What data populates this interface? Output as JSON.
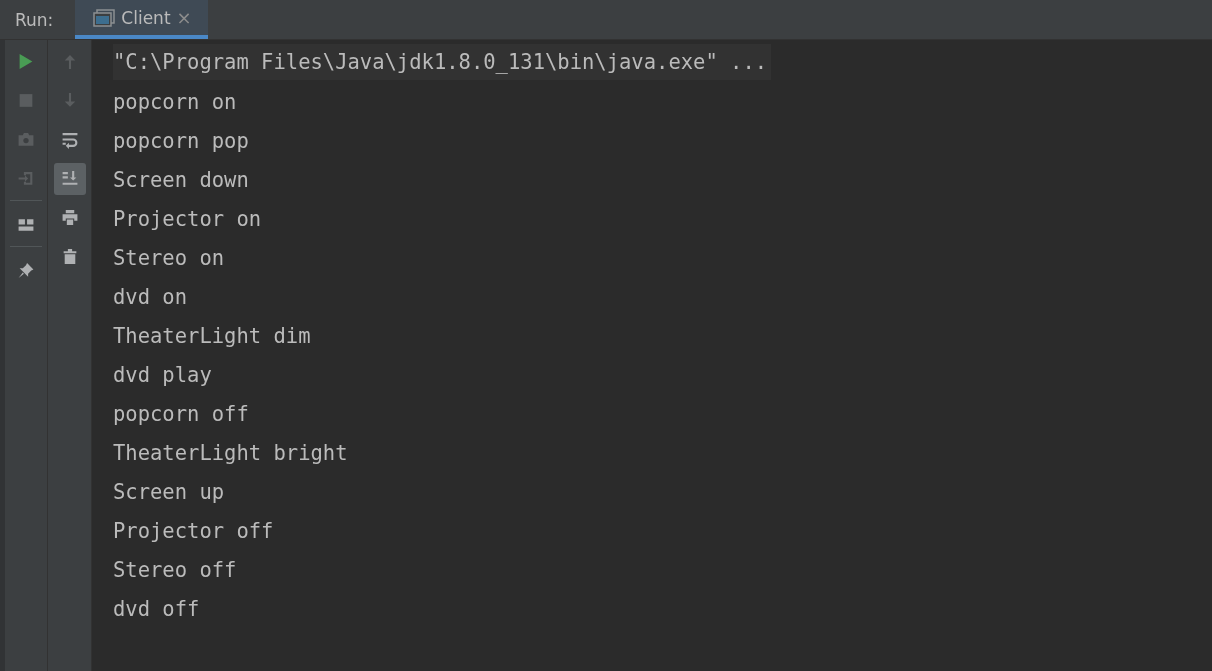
{
  "run_label": "Run:",
  "tabs": [
    {
      "label": "Client",
      "selected": true,
      "close": "×"
    }
  ],
  "toolbar_left": [
    {
      "kind": "run",
      "disabled": false
    },
    {
      "kind": "stop",
      "disabled": true
    },
    {
      "kind": "camera",
      "disabled": true
    },
    {
      "kind": "exit",
      "disabled": true
    },
    {
      "kind": "separator"
    },
    {
      "kind": "layout",
      "disabled": false
    },
    {
      "kind": "separator"
    },
    {
      "kind": "pin",
      "disabled": false
    }
  ],
  "toolbar_right": [
    {
      "kind": "up",
      "disabled": true,
      "on": false
    },
    {
      "kind": "down",
      "disabled": true,
      "on": false
    },
    {
      "kind": "wrap",
      "disabled": false,
      "on": false
    },
    {
      "kind": "scroll-end",
      "disabled": false,
      "on": true
    },
    {
      "kind": "print",
      "disabled": false,
      "on": false
    },
    {
      "kind": "trash",
      "disabled": false,
      "on": false
    }
  ],
  "console": [
    {
      "kind": "command",
      "text": "\"C:\\Program Files\\Java\\jdk1.8.0_131\\bin\\java.exe\" ..."
    },
    {
      "kind": "output",
      "text": "popcorn on"
    },
    {
      "kind": "output",
      "text": "popcorn pop"
    },
    {
      "kind": "output",
      "text": "Screen down"
    },
    {
      "kind": "output",
      "text": "Projector on"
    },
    {
      "kind": "output",
      "text": "Stereo on"
    },
    {
      "kind": "output",
      "text": "dvd on"
    },
    {
      "kind": "output",
      "text": "TheaterLight dim"
    },
    {
      "kind": "output",
      "text": "dvd play"
    },
    {
      "kind": "output",
      "text": "popcorn off"
    },
    {
      "kind": "output",
      "text": "TheaterLight bright"
    },
    {
      "kind": "output",
      "text": "Screen up"
    },
    {
      "kind": "output",
      "text": "Projector off"
    },
    {
      "kind": "output",
      "text": "Stereo off"
    },
    {
      "kind": "output",
      "text": "dvd off"
    }
  ]
}
